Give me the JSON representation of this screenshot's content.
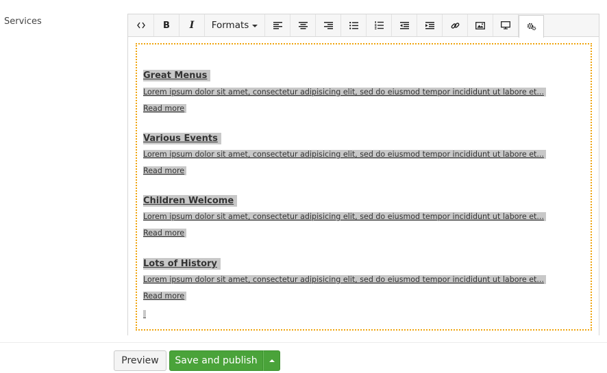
{
  "field": {
    "label": "Services"
  },
  "toolbar": {
    "buttons": [
      {
        "name": "source-code",
        "icon": "code-icon"
      },
      {
        "name": "bold",
        "icon": "bold-icon",
        "glyph": "B"
      },
      {
        "name": "italic",
        "icon": "italic-icon",
        "glyph": "I"
      },
      {
        "name": "formats",
        "label": "Formats"
      },
      {
        "name": "align-left",
        "icon": "align-left-icon"
      },
      {
        "name": "align-center",
        "icon": "align-center-icon"
      },
      {
        "name": "align-right",
        "icon": "align-right-icon"
      },
      {
        "name": "bullet-list",
        "icon": "bullet-list-icon"
      },
      {
        "name": "numbered-list",
        "icon": "numbered-list-icon"
      },
      {
        "name": "outdent",
        "icon": "outdent-icon"
      },
      {
        "name": "indent",
        "icon": "indent-icon"
      },
      {
        "name": "link",
        "icon": "link-icon"
      },
      {
        "name": "image",
        "icon": "image-icon"
      },
      {
        "name": "embed",
        "icon": "monitor-icon"
      },
      {
        "name": "settings",
        "icon": "gears-icon",
        "active": true
      }
    ]
  },
  "content": {
    "sections": [
      {
        "heading": "Great Menus",
        "text": "Lorem ipsum dolor sit amet, consectetur adipisicing elit, sed do eiusmod tempor incididunt ut labore et...",
        "link": "Read more"
      },
      {
        "heading": "Various Events",
        "text": "Lorem ipsum dolor sit amet, consectetur adipisicing elit, sed do eiusmod tempor incididunt ut labore et...",
        "link": "Read more"
      },
      {
        "heading": "Children Welcome",
        "text": "Lorem ipsum dolor sit amet, consectetur adipisicing elit, sed do eiusmod tempor incididunt ut labore et...",
        "link": "Read more"
      },
      {
        "heading": "Lots of History",
        "text": "Lorem ipsum dolor sit amet, consectetur adipisicing elit, sed do eiusmod tempor incididunt ut labore et...",
        "link": "Read more"
      }
    ]
  },
  "actions": {
    "preview_label": "Preview",
    "save_label": "Save and publish"
  },
  "colors": {
    "accent_green": "#4aa33a",
    "selection_border": "#f0a30a",
    "highlight": "#c8c8c8"
  }
}
